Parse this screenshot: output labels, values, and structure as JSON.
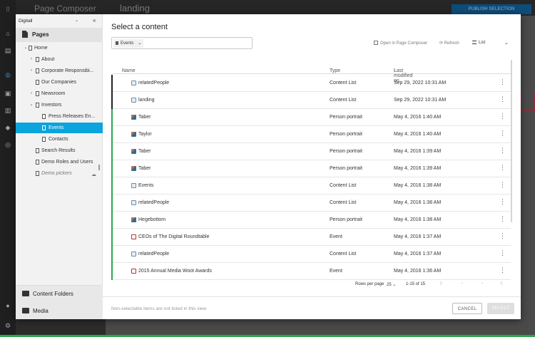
{
  "background": {
    "app_title": "Page Composer",
    "page_name": "landing",
    "publish_label": "PUBLISH SELECTION"
  },
  "sidebar": {
    "site": "Digitall",
    "section_title": "Pages",
    "tree": [
      {
        "label": "Home",
        "toggle": "⌄"
      },
      {
        "label": "About",
        "toggle": "›"
      },
      {
        "label": "Corporate Responsibi...",
        "toggle": "›"
      },
      {
        "label": "Our Companies",
        "toggle": ""
      },
      {
        "label": "Newsroom",
        "toggle": "›"
      },
      {
        "label": "Investors",
        "toggle": "⌄"
      },
      {
        "label": "Press Releases En...",
        "toggle": ""
      },
      {
        "label": "Events",
        "toggle": ""
      },
      {
        "label": "Contacts",
        "toggle": ""
      },
      {
        "label": "Search Results",
        "toggle": ""
      },
      {
        "label": "Demo Roles and Users",
        "toggle": ""
      },
      {
        "label": "Demo pickers",
        "toggle": ""
      }
    ],
    "footer": [
      {
        "label": "Content Folders"
      },
      {
        "label": "Media"
      }
    ]
  },
  "main": {
    "title": "Select a content",
    "filter": "Events",
    "toolbar": {
      "open_in_pc": "Open in Page Composer",
      "refresh": "Refresh",
      "view": "List"
    },
    "columns": {
      "name": "Name",
      "type": "Type",
      "modified": "Last modified on"
    },
    "rows": [
      {
        "name": "relatedPeople",
        "type": "Content List",
        "modified": "Sep 29, 2022 10:31 AM",
        "icon": "list",
        "bar": "#222222"
      },
      {
        "name": "landing",
        "type": "Content List",
        "modified": "Sep 29, 2022 10:31 AM",
        "icon": "list",
        "bar": "#222222"
      },
      {
        "name": "Taber",
        "type": "Person portrait",
        "modified": "May 4, 2016 1:40 AM",
        "icon": "person",
        "bar": "#2aa84a"
      },
      {
        "name": "Taylor",
        "type": "Person portrait",
        "modified": "May 4, 2016 1:40 AM",
        "icon": "person",
        "bar": "#2aa84a"
      },
      {
        "name": "Taber",
        "type": "Person portrait",
        "modified": "May 4, 2016 1:39 AM",
        "icon": "person",
        "bar": "#2aa84a"
      },
      {
        "name": "Taber",
        "type": "Person portrait",
        "modified": "May 4, 2016 1:39 AM",
        "icon": "person",
        "bar": "#2aa84a"
      },
      {
        "name": "Events",
        "type": "Content List",
        "modified": "May 4, 2016 1:38 AM",
        "icon": "list",
        "bar": "#2aa84a"
      },
      {
        "name": "relatedPeople",
        "type": "Content List",
        "modified": "May 4, 2016 1:38 AM",
        "icon": "list",
        "bar": "#2aa84a"
      },
      {
        "name": "Hegebottom",
        "type": "Person portrait",
        "modified": "May 4, 2016 1:38 AM",
        "icon": "person",
        "bar": "#2aa84a"
      },
      {
        "name": "CEOs of The Digital Roundtable",
        "type": "Event",
        "modified": "May 4, 2016 1:37 AM",
        "icon": "event",
        "bar": "#2aa84a"
      },
      {
        "name": "relatedPeople",
        "type": "Content List",
        "modified": "May 4, 2016 1:37 AM",
        "icon": "list",
        "bar": "#2aa84a"
      },
      {
        "name": "2015 Annual Media Woot Awards",
        "type": "Event",
        "modified": "May 4, 2016 1:36 AM",
        "icon": "event",
        "bar": "#2aa84a"
      }
    ],
    "pagination": {
      "rows_label": "Rows per page",
      "rows_value": "25",
      "range": "1-15 of 15"
    },
    "footer": {
      "note": "Non-selectable items are not listed in this view",
      "cancel": "CANCEL",
      "select": "SELECT"
    }
  },
  "colors": {
    "accent": "#0ba4dc",
    "published": "#2aa84a",
    "modified": "#222222"
  }
}
